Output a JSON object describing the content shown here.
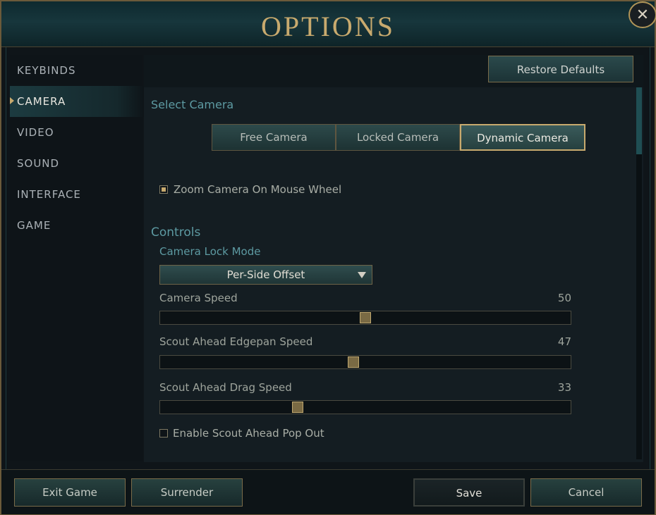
{
  "window": {
    "title": "OPTIONS",
    "close_label": "✕"
  },
  "sidebar": {
    "items": [
      {
        "label": "KEYBINDS"
      },
      {
        "label": "CAMERA"
      },
      {
        "label": "VIDEO"
      },
      {
        "label": "SOUND"
      },
      {
        "label": "INTERFACE"
      },
      {
        "label": "GAME"
      }
    ],
    "active": "CAMERA"
  },
  "toolbar": {
    "restore_label": "Restore Defaults"
  },
  "camera": {
    "select_label": "Select Camera",
    "options": [
      {
        "label": "Free Camera"
      },
      {
        "label": "Locked Camera"
      },
      {
        "label": "Dynamic Camera"
      }
    ],
    "selected": "Dynamic Camera",
    "zoom_label": "Zoom Camera On Mouse Wheel",
    "zoom_checked": true
  },
  "controls": {
    "heading": "Controls",
    "lock_mode_label": "Camera Lock Mode",
    "lock_mode_value": "Per-Side Offset",
    "camera_speed_label": "Camera Speed",
    "camera_speed_value": "50",
    "edgepan_label": "Scout Ahead Edgepan Speed",
    "edgepan_value": "47",
    "drag_label": "Scout Ahead Drag Speed",
    "drag_value": "33",
    "popout_label": "Enable Scout Ahead Pop Out",
    "popout_checked": false
  },
  "footer": {
    "exit_label": "Exit Game",
    "surrender_label": "Surrender",
    "save_label": "Save",
    "cancel_label": "Cancel"
  },
  "colors": {
    "accent_gold": "#c8aa6e",
    "teal_heading": "#5d9aa2"
  }
}
